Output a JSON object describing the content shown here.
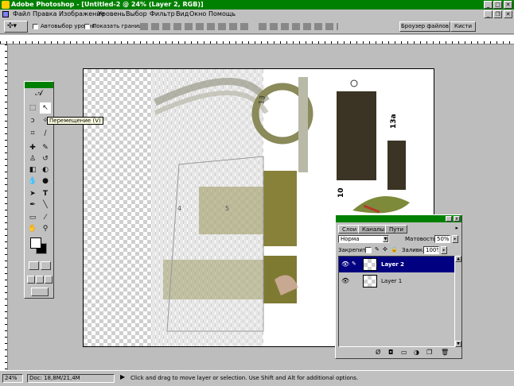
{
  "app": {
    "title": "Adobe Photoshop - [Untitled-2 @ 24% (Layer 2, RGB)]"
  },
  "menu": [
    "Файл",
    "Правка",
    "Изображение",
    "Уровень",
    "Выбор",
    "Фильтр",
    "Вид",
    "Окно",
    "Помощь"
  ],
  "options": {
    "auto_select_label": "Автовыбор уровня",
    "show_bounds_label": "Показать границы",
    "tab_browser": "Броузер файлов",
    "tab_brushes": "Кисти"
  },
  "tooltip": "Перемещение (V)",
  "canvas": {
    "labels": [
      "13",
      "13a",
      "10",
      "5",
      "4"
    ]
  },
  "layers_panel": {
    "tabs": [
      "Слои",
      "Каналы",
      "Пути"
    ],
    "blend_mode": "Норма",
    "opacity_label": "Матовость:",
    "opacity_value": "50%",
    "lock_label": "Закрепить:",
    "fill_label": "Заливка:",
    "fill_value": "100%",
    "layers": [
      {
        "name": "Layer 2",
        "selected": true
      },
      {
        "name": "Layer 1",
        "selected": false
      }
    ]
  },
  "status": {
    "zoom": "24%",
    "doc_info": "Doc: 18,8M/21,4M",
    "hint": "Click and drag to move layer or selection. Use Shift and Alt for additional options."
  },
  "colors": {
    "title_bar": "#008000",
    "selected_layer": "#000080"
  }
}
